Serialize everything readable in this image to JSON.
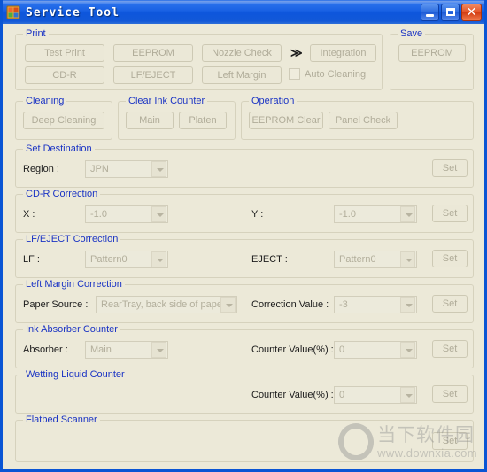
{
  "window": {
    "title": "Service Tool",
    "icon": "app-icon",
    "minimize_label": "Minimize",
    "maximize_label": "Maximize",
    "close_label": "Close",
    "close_glyph": "✕",
    "accent_color": "#0a55d4",
    "client_bg": "#ece9d8",
    "legend_color": "#1b34c4"
  },
  "print": {
    "legend": "Print",
    "buttons": [
      {
        "label": "Test Print"
      },
      {
        "label": "EEPROM"
      },
      {
        "label": "Nozzle Check"
      },
      {
        "label": "CD-R"
      },
      {
        "label": "LF/EJECT"
      },
      {
        "label": "Left Margin"
      }
    ],
    "chevron": "≫",
    "integration_label": "Integration",
    "auto_cleaning_label": "Auto Cleaning",
    "auto_cleaning_checked": false
  },
  "save": {
    "legend": "Save",
    "eeprom_label": "EEPROM"
  },
  "cleaning": {
    "legend": "Cleaning",
    "deep_cleaning_label": "Deep Cleaning"
  },
  "clear_ink_counter": {
    "legend": "Clear Ink Counter",
    "main_label": "Main",
    "platen_label": "Platen"
  },
  "operation": {
    "legend": "Operation",
    "eeprom_clear_label": "EEPROM Clear",
    "panel_check_label": "Panel Check"
  },
  "set_destination": {
    "legend": "Set Destination",
    "region_label": "Region :",
    "region_value": "JPN",
    "set_label": "Set"
  },
  "cdr_correction": {
    "legend": "CD-R Correction",
    "x_label": "X :",
    "x_value": "-1.0",
    "y_label": "Y :",
    "y_value": "-1.0",
    "set_label": "Set"
  },
  "lf_eject_correction": {
    "legend": "LF/EJECT Correction",
    "lf_label": "LF :",
    "lf_value": "Pattern0",
    "eject_label": "EJECT :",
    "eject_value": "Pattern0",
    "set_label": "Set"
  },
  "left_margin_correction": {
    "legend": "Left Margin Correction",
    "paper_source_label": "Paper Source :",
    "paper_source_value": "RearTray, back side of paper",
    "correction_value_label": "Correction Value :",
    "correction_value": "-3",
    "set_label": "Set"
  },
  "ink_absorber_counter": {
    "legend": "Ink Absorber Counter",
    "absorber_label": "Absorber :",
    "absorber_value": "Main",
    "counter_label": "Counter Value(%) :",
    "counter_value": "0",
    "set_label": "Set"
  },
  "wetting_liquid_counter": {
    "legend": "Wetting Liquid Counter",
    "counter_label": "Counter Value(%) :",
    "counter_value": "0",
    "set_label": "Set"
  },
  "flatbed_scanner": {
    "legend": "Flatbed Scanner",
    "set_label": "Set"
  },
  "watermark": {
    "cn_text": "当下软件园",
    "url_text": "www.downxia.com"
  }
}
